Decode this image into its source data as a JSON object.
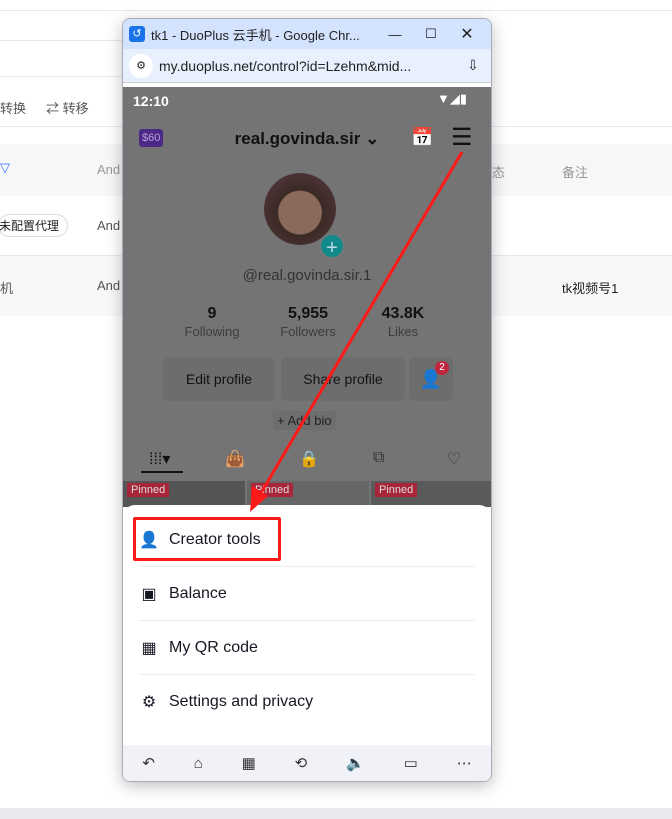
{
  "background": {
    "toolbar": [
      "转换",
      "⇄ 转移"
    ],
    "table_header": [
      "And",
      "态",
      "备注"
    ],
    "rows": [
      {
        "c1": "未配置代理",
        "c2": "And"
      },
      {
        "c1": "机",
        "c2": "And",
        "note": "tk视频号1"
      }
    ]
  },
  "window": {
    "title": "tk1 - DuoPlus 云手机 - Google Chr...",
    "url": "my.duoplus.net/control?id=Lzehm&mid..."
  },
  "phone": {
    "time": "12:10",
    "coin_badge": "$60",
    "username": "real.govinda.sir",
    "handle": "@real.govinda.sir.1",
    "stats": [
      {
        "value": "9",
        "label": "Following"
      },
      {
        "value": "5,955",
        "label": "Followers"
      },
      {
        "value": "43.8K",
        "label": "Likes"
      }
    ],
    "edit_profile": "Edit profile",
    "share_profile": "Share profile",
    "friend_badge": "2",
    "add_bio": "+ Add bio",
    "pinned": "Pinned",
    "menu": [
      {
        "label": "Creator tools",
        "icon": "creator-tools-icon"
      },
      {
        "label": "Balance",
        "icon": "wallet-icon"
      },
      {
        "label": "My QR code",
        "icon": "qr-code-icon"
      },
      {
        "label": "Settings and privacy",
        "icon": "gear-icon"
      }
    ]
  },
  "colors": {
    "highlight": "#ff1a1a",
    "titlebar": "#d3e3fd"
  }
}
